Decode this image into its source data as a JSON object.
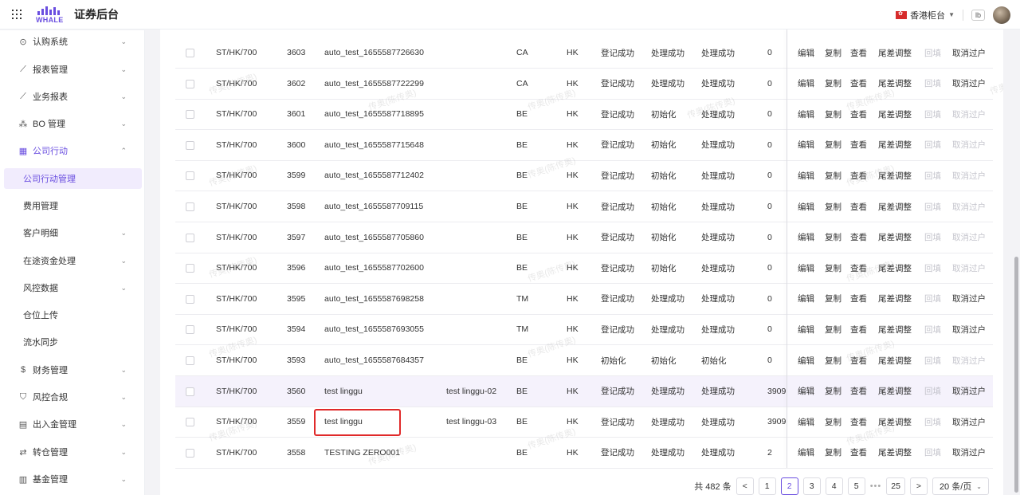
{
  "header": {
    "app_title": "证券后台",
    "logo_text": "WHALE",
    "region": "香港柜台",
    "user_initials": "lb"
  },
  "sidebar": {
    "items": [
      {
        "label": "认购系统",
        "icon": "cart-icon",
        "arrow": "⌄"
      },
      {
        "label": "报表管理",
        "icon": "chart-line-icon",
        "arrow": "⌄"
      },
      {
        "label": "业务报表",
        "icon": "chart-line-icon",
        "arrow": "⌄"
      },
      {
        "label": "BO 管理",
        "icon": "cluster-icon",
        "arrow": "⌄"
      },
      {
        "label": "公司行动",
        "icon": "calendar-icon",
        "arrow": "⌃"
      },
      {
        "label": "公司行动管理",
        "sub": true,
        "active": true
      },
      {
        "label": "费用管理",
        "sub": true
      },
      {
        "label": "客户明细",
        "sub": true,
        "arrow": "⌄"
      },
      {
        "label": "在途资金处理",
        "sub": true,
        "arrow": "⌄"
      },
      {
        "label": "风控数据",
        "sub": true,
        "arrow": "⌄"
      },
      {
        "label": "仓位上传",
        "sub": true
      },
      {
        "label": "流水同步",
        "sub": true
      },
      {
        "label": "财务管理",
        "icon": "coin-icon",
        "arrow": "⌄"
      },
      {
        "label": "风控合规",
        "icon": "shield-icon",
        "arrow": "⌄"
      },
      {
        "label": "出入金管理",
        "icon": "ledger-icon",
        "arrow": "⌄"
      },
      {
        "label": "转仓管理",
        "icon": "transfer-icon",
        "arrow": "⌄"
      },
      {
        "label": "基金管理",
        "icon": "document-icon",
        "arrow": "⌄"
      }
    ]
  },
  "watermark": "传奥(陈传奥)",
  "table": {
    "rows": [
      {
        "account": "ST/HK/700",
        "id": "3603",
        "name": "auto_test_1655587726630",
        "desc": "",
        "type": "CA",
        "market": "HK",
        "s1": "登记成功",
        "s2": "处理成功",
        "s3": "处理成功",
        "num": "0",
        "cancel_enabled": true
      },
      {
        "account": "ST/HK/700",
        "id": "3602",
        "name": "auto_test_1655587722299",
        "desc": "",
        "type": "CA",
        "market": "HK",
        "s1": "登记成功",
        "s2": "处理成功",
        "s3": "处理成功",
        "num": "0",
        "cancel_enabled": true
      },
      {
        "account": "ST/HK/700",
        "id": "3601",
        "name": "auto_test_1655587718895",
        "desc": "",
        "type": "BE",
        "market": "HK",
        "s1": "登记成功",
        "s2": "初始化",
        "s3": "处理成功",
        "num": "0",
        "cancel_enabled": false
      },
      {
        "account": "ST/HK/700",
        "id": "3600",
        "name": "auto_test_1655587715648",
        "desc": "",
        "type": "BE",
        "market": "HK",
        "s1": "登记成功",
        "s2": "初始化",
        "s3": "处理成功",
        "num": "0",
        "cancel_enabled": false
      },
      {
        "account": "ST/HK/700",
        "id": "3599",
        "name": "auto_test_1655587712402",
        "desc": "",
        "type": "BE",
        "market": "HK",
        "s1": "登记成功",
        "s2": "初始化",
        "s3": "处理成功",
        "num": "0",
        "cancel_enabled": false
      },
      {
        "account": "ST/HK/700",
        "id": "3598",
        "name": "auto_test_1655587709115",
        "desc": "",
        "type": "BE",
        "market": "HK",
        "s1": "登记成功",
        "s2": "初始化",
        "s3": "处理成功",
        "num": "0",
        "cancel_enabled": false
      },
      {
        "account": "ST/HK/700",
        "id": "3597",
        "name": "auto_test_1655587705860",
        "desc": "",
        "type": "BE",
        "market": "HK",
        "s1": "登记成功",
        "s2": "初始化",
        "s3": "处理成功",
        "num": "0",
        "cancel_enabled": false
      },
      {
        "account": "ST/HK/700",
        "id": "3596",
        "name": "auto_test_1655587702600",
        "desc": "",
        "type": "BE",
        "market": "HK",
        "s1": "登记成功",
        "s2": "初始化",
        "s3": "处理成功",
        "num": "0",
        "cancel_enabled": false
      },
      {
        "account": "ST/HK/700",
        "id": "3595",
        "name": "auto_test_1655587698258",
        "desc": "",
        "type": "TM",
        "market": "HK",
        "s1": "登记成功",
        "s2": "处理成功",
        "s3": "处理成功",
        "num": "0",
        "cancel_enabled": true
      },
      {
        "account": "ST/HK/700",
        "id": "3594",
        "name": "auto_test_1655587693055",
        "desc": "",
        "type": "TM",
        "market": "HK",
        "s1": "登记成功",
        "s2": "处理成功",
        "s3": "处理成功",
        "num": "0",
        "cancel_enabled": true
      },
      {
        "account": "ST/HK/700",
        "id": "3593",
        "name": "auto_test_1655587684357",
        "desc": "",
        "type": "BE",
        "market": "HK",
        "s1": "初始化",
        "s2": "初始化",
        "s3": "初始化",
        "num": "0",
        "cancel_enabled": false
      },
      {
        "account": "ST/HK/700",
        "id": "3560",
        "name": "test linggu",
        "desc": "test linggu-02",
        "type": "BE",
        "market": "HK",
        "s1": "登记成功",
        "s2": "处理成功",
        "s3": "处理成功",
        "num": "3909",
        "cancel_enabled": true,
        "highlight": true
      },
      {
        "account": "ST/HK/700",
        "id": "3559",
        "name": "test linggu",
        "desc": "test linggu-03",
        "type": "BE",
        "market": "HK",
        "s1": "登记成功",
        "s2": "处理成功",
        "s3": "处理成功",
        "num": "3909",
        "cancel_enabled": true,
        "boxed": true
      },
      {
        "account": "ST/HK/700",
        "id": "3558",
        "name": "TESTING ZERO001",
        "desc": "",
        "type": "BE",
        "market": "HK",
        "s1": "登记成功",
        "s2": "处理成功",
        "s3": "处理成功",
        "num": "2",
        "cancel_enabled": true
      }
    ],
    "actions": {
      "edit": "编辑",
      "copy": "复制",
      "view": "查看",
      "adjust": "尾差调整",
      "backfill": "回填",
      "cancel": "取消过户"
    }
  },
  "pagination": {
    "total_label": "共 482 条",
    "prev": "<",
    "pages": [
      "1",
      "2",
      "3",
      "4",
      "5"
    ],
    "current": "2",
    "ellipsis": "•••",
    "last": "25",
    "next": ">",
    "page_size": "20 条/页"
  },
  "colors": {
    "accent": "#6a4ee0",
    "highlight_box": "#e02a2a"
  }
}
